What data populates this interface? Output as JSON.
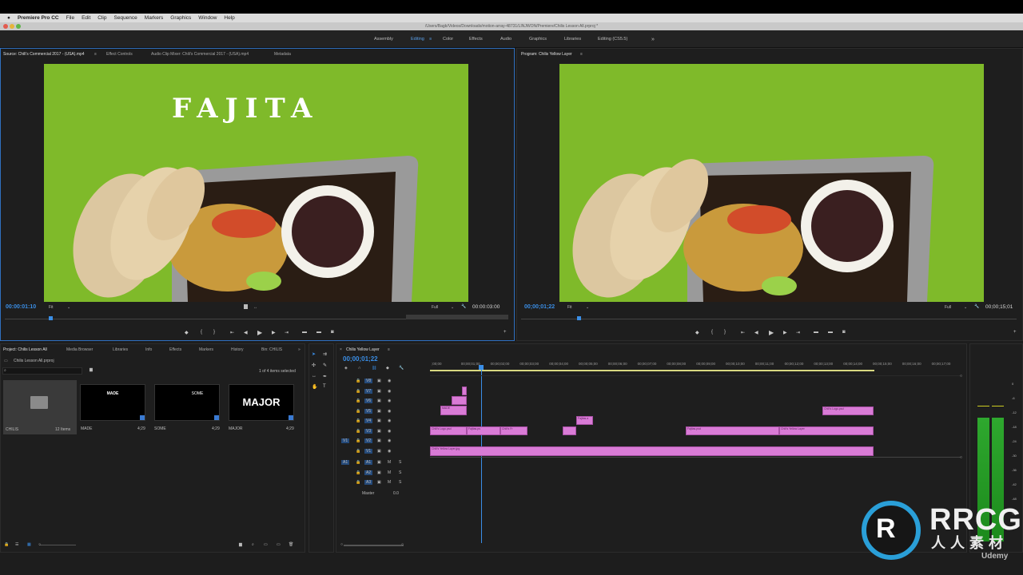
{
  "menu": {
    "apple": "",
    "app": "Premiere Pro CC",
    "items": [
      "File",
      "Edit",
      "Clip",
      "Sequence",
      "Markers",
      "Graphics",
      "Window",
      "Help"
    ]
  },
  "window_title": "/Users/Bagb/Videos/Downloads/motion-array-48731/LINJWON/Premiere/Chilis Lesson All.prproj *",
  "workspaces": [
    {
      "label": "Assembly"
    },
    {
      "label": "Editing"
    },
    {
      "label": "Color"
    },
    {
      "label": "Effects"
    },
    {
      "label": "Audio"
    },
    {
      "label": "Graphics"
    },
    {
      "label": "Libraries"
    },
    {
      "label": "Editing (CS5.5)"
    }
  ],
  "source": {
    "tabs": [
      "Source: Chili's Commercial 2017 - (USA).mp4",
      "Effect Controls",
      "Audio Clip Mixer: Chili's Commercial 2017 - (USA).mp4",
      "Metadata"
    ],
    "overlay_text": "FAJITA",
    "timecode": "00:00:01:10",
    "zoom": "Fit",
    "resolution": "Full",
    "duration": "00:00:03:00"
  },
  "program": {
    "tab": "Program: Chilis Yellow Layer",
    "timecode": "00;00;01;22",
    "zoom": "Fit",
    "resolution": "Full",
    "duration": "00;00;15;01"
  },
  "project": {
    "tabs": [
      "Project: Chilis Lesson All",
      "Media Browser",
      "Libraries",
      "Info",
      "Effects",
      "Markers",
      "History",
      "Bin: CHILIS"
    ],
    "file": "Chilis Lesson All.prproj",
    "selection_info": "1 of 4 items selected",
    "items": [
      {
        "name": "CHILIS",
        "meta": "12 Items",
        "thumb_text": ""
      },
      {
        "name": "MADE",
        "meta": "4;29",
        "thumb_text": "MADE"
      },
      {
        "name": "SOME",
        "meta": "4;29",
        "thumb_text": "SOME"
      },
      {
        "name": "MAJOR",
        "meta": "4;29",
        "thumb_text": "MAJOR"
      }
    ]
  },
  "timeline": {
    "tab": "Chilis Yellow Layer",
    "timecode": "00;00;01;22",
    "ruler": [
      ";00;00",
      "00;00;01;00",
      "00;00;02;00",
      "00;00;03;00",
      "00;00;04;00",
      "00;00;05;00",
      "00;00;06;00",
      "00;00;07;00",
      "00;00;08;00",
      "00;00;09;00",
      "00;00;10;00",
      "00;00;11;00",
      "00;00;12;00",
      "00;00;13;00",
      "00;00;14;00",
      "00;00;15;00",
      "00;00;16;00",
      "00;00;17;00"
    ],
    "video_tracks": [
      "V8",
      "V7",
      "V6",
      "V5",
      "V4",
      "V3",
      "V2",
      "V1"
    ],
    "audio_tracks": [
      "A1",
      "A2",
      "A3"
    ],
    "master_label": "Master",
    "master_value": "0.0",
    "clips": {
      "v5a": "MADE",
      "v5b": "Chili's Logo.psd",
      "v4": "Fajitas.a",
      "v3a": "Chili's Logo.psd",
      "v3b": "Fajitas.ps",
      "v3c": "Chili's Fr",
      "v3d": "Fajitas.psd",
      "v3e": "Chili's Yellow Layer",
      "v3f": "Chili's Background.jpg",
      "v1": "Chili's Yellow Layer.jpg"
    }
  },
  "meter_scale": [
    "0",
    "-6",
    "-12",
    "-18",
    "-24",
    "-30",
    "-36",
    "-42",
    "-48",
    "-54",
    "-dB"
  ],
  "watermark": {
    "brand": "RRCG",
    "sub": "人人素材",
    "udemy": "Udemy"
  },
  "colors": {
    "accent": "#3a8ee6",
    "clip": "#d97bd6",
    "screen": "#7fba2a"
  }
}
